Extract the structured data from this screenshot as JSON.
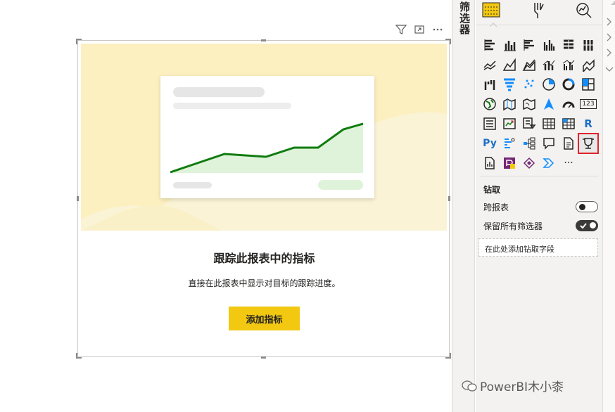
{
  "visual": {
    "title": "跟踪此报表中的指标",
    "subtitle": "直接在此报表中显示对目标的跟踪进度。",
    "add_button": "添加指标"
  },
  "filters_pane": {
    "label": "筛选器"
  },
  "viz_pane": {
    "grid_icons": [
      "stacked-bar-chart-icon",
      "stacked-column-chart-icon",
      "clustered-bar-chart-icon",
      "clustered-column-chart-icon",
      "100-stacked-bar-chart-icon",
      "100-stacked-column-chart-icon",
      "line-chart-icon",
      "area-chart-icon",
      "stacked-area-chart-icon",
      "line-and-stacked-column-chart-icon",
      "line-and-clustered-column-chart-icon",
      "ribbon-chart-icon",
      "waterfall-chart-icon",
      "funnel-chart-icon",
      "scatter-chart-icon",
      "pie-chart-icon",
      "donut-chart-icon",
      "treemap-icon",
      "map-icon",
      "filled-map-icon",
      "shape-map-icon",
      "azure-map-icon",
      "gauge-icon",
      "card-icon",
      "multi-row-card-icon",
      "kpi-icon",
      "slicer-icon",
      "table-icon",
      "matrix-icon",
      "r-visual-icon",
      "python-visual-icon",
      "key-influencers-icon",
      "decomposition-tree-icon",
      "qa-icon",
      "smart-narrative-icon",
      "metrics-icon",
      "paginated-report-icon",
      "power-apps-icon",
      "power-automate-icon",
      "get-more-visuals-icon"
    ],
    "card_text": "123",
    "r_text": "R",
    "py_text": "Py",
    "more_text": "···",
    "drill": {
      "title": "钻取",
      "cross_report_label": "跨报表",
      "cross_report": false,
      "keep_filters_label": "保留所有筛选器",
      "keep_filters": true,
      "drop_placeholder": "在此处添加钻取字段"
    }
  },
  "watermark": "PowerBI木小桼",
  "colors": {
    "accent_yellow": "#f2c811",
    "line_green": "#107c10",
    "selection_red": "#e0242b"
  }
}
